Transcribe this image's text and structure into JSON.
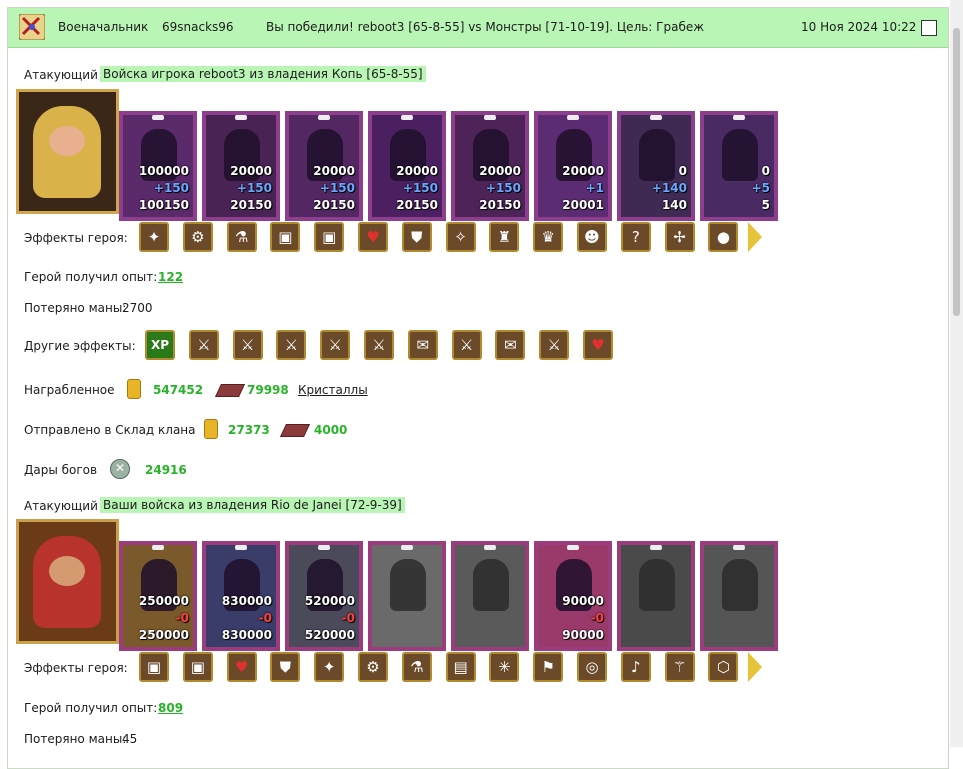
{
  "header": {
    "role": "Военачальник",
    "player": "69snacks96",
    "result": "Вы победили! reboot3 [65-8-55] vs Монстры [71-10-19]. Цель: Грабеж",
    "datetime": "10 Ноя 2024 10:22",
    "icon": "crossed-swords-icon"
  },
  "battle1": {
    "attacker_label": "Атакующий",
    "attacker_title": "Войска игрока reboot3 из владения Копь [65-8-55]",
    "units": [
      {
        "n1": "100000",
        "n2": "+150",
        "n3": "100150"
      },
      {
        "n1": "20000",
        "n2": "+150",
        "n3": "20150"
      },
      {
        "n1": "20000",
        "n2": "+150",
        "n3": "20150"
      },
      {
        "n1": "20000",
        "n2": "+150",
        "n3": "20150"
      },
      {
        "n1": "20000",
        "n2": "+150",
        "n3": "20150"
      },
      {
        "n1": "20000",
        "n2": "+1",
        "n3": "20001"
      },
      {
        "n1": "0",
        "n2": "+140",
        "n3": "140"
      },
      {
        "n1": "0",
        "n2": "+5",
        "n3": "5"
      }
    ],
    "hero_effects_label": "Эффекты героя:",
    "hero_effects": [
      "gem-tree-icon",
      "armor-icon",
      "potion-icon",
      "treasure-chest-icon",
      "fire-chest-icon",
      "heart-icon",
      "shield-icon",
      "wing-icon",
      "totem-icon",
      "gold-armor-icon",
      "goblin-icon",
      "question-icon",
      "compass-icon",
      "gold-orb-icon"
    ],
    "exp_label": "Герой получил опыт:",
    "exp_value": "122",
    "mana_label": "Потеряно маны:",
    "mana_value": "2700",
    "other_effects_label": "Другие эффекты:",
    "other_effects": [
      "xp-icon",
      "sword-icon",
      "sword-icon",
      "sword-icon",
      "sword-icon",
      "sword-icon",
      "scroll-icon",
      "sword-icon",
      "scroll-icon",
      "sword-icon",
      "sword-heart-icon"
    ],
    "loot_label": "Награбленное",
    "loot_gold": "547452",
    "loot_crystal": "79998",
    "loot_link": "Кристаллы",
    "clan_label": "Отправлено в Склад клана",
    "clan_gold": "27373",
    "clan_crystal": "4000",
    "gifts_label": "Дары богов",
    "gifts_value": "24916"
  },
  "battle2": {
    "attacker_label": "Атакующий",
    "attacker_title": "Ваши войска из владения Rio de Janei [72-9-39]",
    "units": [
      {
        "n1": "250000",
        "n2": "-0",
        "n3": "250000"
      },
      {
        "n1": "830000",
        "n2": "-0",
        "n3": "830000"
      },
      {
        "n1": "520000",
        "n2": "-0",
        "n3": "520000"
      },
      {
        "n1": "",
        "n2": "",
        "n3": ""
      },
      {
        "n1": "",
        "n2": "",
        "n3": ""
      },
      {
        "n1": "90000",
        "n2": "-0",
        "n3": "90000"
      },
      {
        "n1": "",
        "n2": "",
        "n3": ""
      },
      {
        "n1": "",
        "n2": "",
        "n3": ""
      }
    ],
    "hero_effects_label": "Эффекты героя:",
    "hero_effects": [
      "treasure-chest-icon",
      "fire-chest-icon",
      "heart-icon",
      "shield-icon",
      "gem-tree-icon",
      "armor-icon",
      "potion-icon",
      "barrel-icon",
      "web-icon",
      "banner-icon",
      "ring-icon",
      "horn-icon",
      "staff-icon",
      "rune-icon"
    ],
    "exp_label": "Герой получил опыт:",
    "exp_value": "809",
    "mana_label": "Потеряно маны:",
    "mana_value": "45"
  }
}
